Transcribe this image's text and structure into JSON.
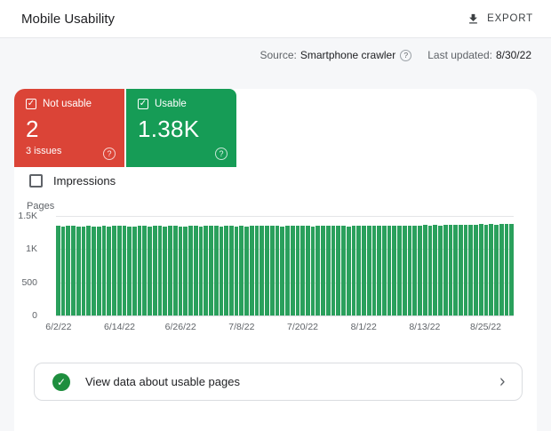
{
  "header": {
    "title": "Mobile Usability",
    "export_label": "EXPORT"
  },
  "meta": {
    "source_label": "Source:",
    "source_value": "Smartphone crawler",
    "help_glyph": "?",
    "updated_label": "Last updated:",
    "updated_value": "8/30/22"
  },
  "cards": {
    "not_usable": {
      "label": "Not usable",
      "value": "2",
      "sub": "3 issues",
      "checked": true,
      "check_glyph": "✓",
      "help_glyph": "?",
      "color": "#db4437"
    },
    "usable": {
      "label": "Usable",
      "value": "1.38K",
      "checked": true,
      "check_glyph": "✓",
      "help_glyph": "?",
      "color": "#169c56"
    }
  },
  "impressions": {
    "label": "Impressions",
    "checked": false
  },
  "chart_data": {
    "type": "bar",
    "title": "",
    "ylabel": "Pages",
    "xlabel": "",
    "ylim": [
      0,
      1500
    ],
    "y_ticks": [
      {
        "label": "1.5K",
        "value": 1500
      },
      {
        "label": "1K",
        "value": 1000
      },
      {
        "label": "500",
        "value": 500
      },
      {
        "label": "0",
        "value": 0
      }
    ],
    "grid": true,
    "legend": "none",
    "date_range": [
      "6/2/22",
      "8/30/22"
    ],
    "x_tick_labels": [
      "6/2/22",
      "6/14/22",
      "6/26/22",
      "7/8/22",
      "7/20/22",
      "8/1/22",
      "8/13/22",
      "8/25/22"
    ],
    "x_tick_indices": [
      0,
      12,
      24,
      36,
      48,
      60,
      72,
      84
    ],
    "series": [
      {
        "name": "Usable pages",
        "color": "#2aa05c",
        "values": [
          1350,
          1345,
          1352,
          1348,
          1340,
          1344,
          1351,
          1338,
          1346,
          1350,
          1342,
          1347,
          1353,
          1349,
          1336,
          1344,
          1350,
          1347,
          1341,
          1352,
          1348,
          1343,
          1355,
          1350,
          1345,
          1339,
          1347,
          1352,
          1346,
          1350,
          1353,
          1348,
          1342,
          1356,
          1350,
          1346,
          1351,
          1344,
          1349,
          1355,
          1350,
          1347,
          1353,
          1348,
          1343,
          1356,
          1351,
          1347,
          1352,
          1349,
          1345,
          1350,
          1356,
          1352,
          1348,
          1354,
          1350,
          1346,
          1352,
          1357,
          1353,
          1349,
          1355,
          1351,
          1347,
          1354,
          1358,
          1353,
          1350,
          1356,
          1360,
          1356,
          1362,
          1358,
          1364,
          1360,
          1366,
          1362,
          1368,
          1364,
          1370,
          1366,
          1372,
          1375,
          1371,
          1377,
          1373,
          1378,
          1375,
          1380
        ]
      }
    ]
  },
  "footer_card": {
    "label": "View data about usable pages",
    "check_glyph": "✓",
    "chevron_glyph": "›",
    "icon_color": "#1e8e3e"
  }
}
